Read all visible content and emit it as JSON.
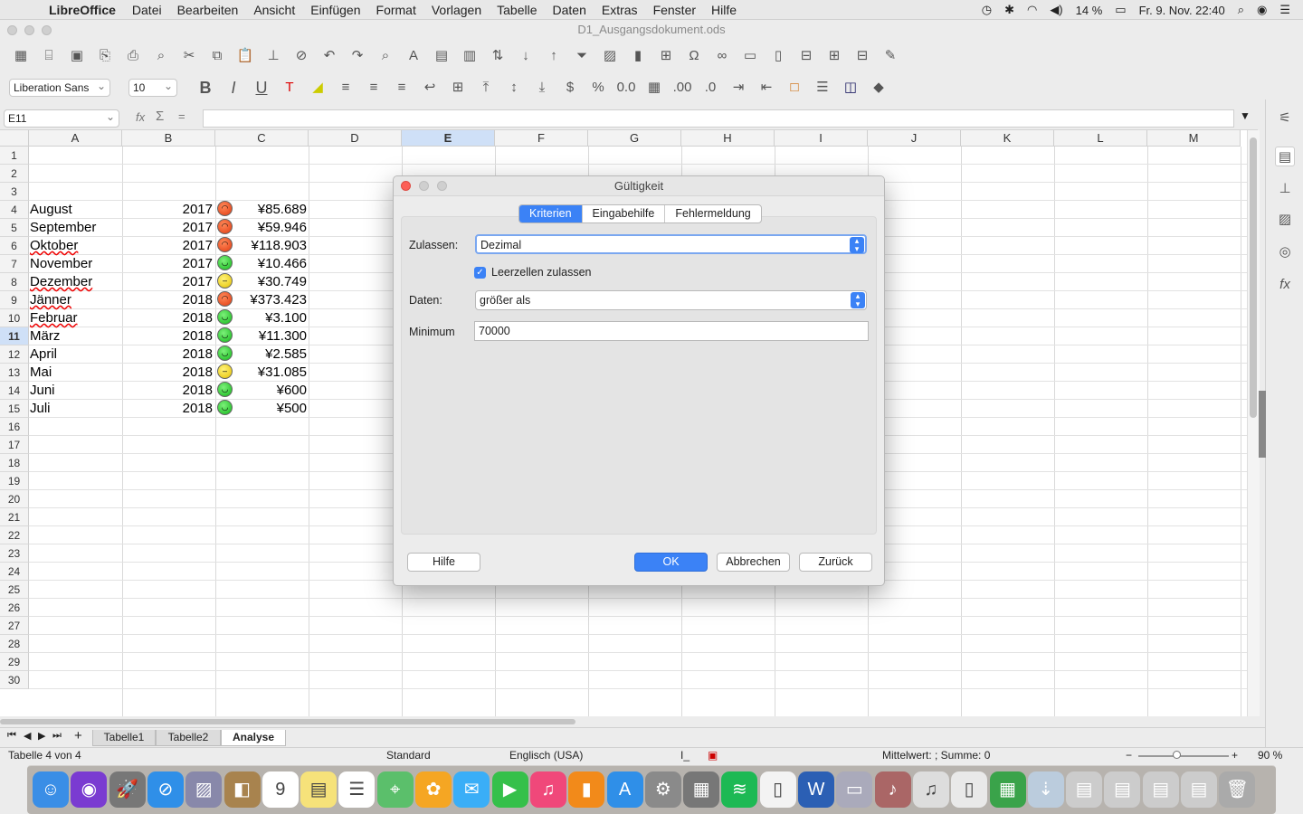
{
  "menubar": {
    "app": "LibreOffice",
    "items": [
      "Datei",
      "Bearbeiten",
      "Ansicht",
      "Einfügen",
      "Format",
      "Vorlagen",
      "Tabelle",
      "Daten",
      "Extras",
      "Fenster",
      "Hilfe"
    ],
    "battery": "14 %",
    "datetime": "Fr. 9. Nov.  22:40"
  },
  "window": {
    "title": "D1_Ausgangsdokument.ods"
  },
  "format_toolbar": {
    "font": "Liberation Sans",
    "size": "10"
  },
  "formula_bar": {
    "cell_ref": "E11",
    "fx": "fx",
    "sum": "Σ",
    "eq": "="
  },
  "columns": [
    "A",
    "B",
    "C",
    "D",
    "E",
    "F",
    "G",
    "H",
    "I",
    "J",
    "K",
    "L",
    "M"
  ],
  "rows": [
    "1",
    "2",
    "3",
    "4",
    "5",
    "6",
    "7",
    "8",
    "9",
    "10",
    "11",
    "12",
    "13",
    "14",
    "15",
    "16",
    "17",
    "18",
    "19",
    "20",
    "21",
    "22",
    "23",
    "24",
    "25",
    "26",
    "27",
    "28",
    "29",
    "30"
  ],
  "data_rows": [
    {
      "month": "August",
      "year": "2017",
      "mood": "red",
      "amount": "¥85.689"
    },
    {
      "month": "September",
      "year": "2017",
      "mood": "red",
      "amount": "¥59.946"
    },
    {
      "month": "Oktober",
      "year": "2017",
      "mood": "red",
      "amount": "¥118.903"
    },
    {
      "month": "November",
      "year": "2017",
      "mood": "green",
      "amount": "¥10.466"
    },
    {
      "month": "Dezember",
      "year": "2017",
      "mood": "yellow",
      "amount": "¥30.749"
    },
    {
      "month": "Jänner",
      "year": "2018",
      "mood": "red",
      "amount": "¥373.423"
    },
    {
      "month": "Februar",
      "year": "2018",
      "mood": "green",
      "amount": "¥3.100"
    },
    {
      "month": "März",
      "year": "2018",
      "mood": "green",
      "amount": "¥11.300"
    },
    {
      "month": "April",
      "year": "2018",
      "mood": "green",
      "amount": "¥2.585"
    },
    {
      "month": "Mai",
      "year": "2018",
      "mood": "yellow",
      "amount": "¥31.085"
    },
    {
      "month": "Juni",
      "year": "2018",
      "mood": "green",
      "amount": "¥600"
    },
    {
      "month": "Juli",
      "year": "2018",
      "mood": "green",
      "amount": "¥500"
    }
  ],
  "sheet_tabs": [
    "Tabelle1",
    "Tabelle2",
    "Analyse"
  ],
  "status": {
    "sheet": "Tabelle 4 von 4",
    "style": "Standard",
    "language": "Englisch (USA)",
    "stats": "Mittelwert: ; Summe: 0",
    "zoom": "90 %"
  },
  "dialog": {
    "title": "Gültigkeit",
    "tabs": [
      "Kriterien",
      "Eingabehilfe",
      "Fehlermeldung"
    ],
    "allow_label": "Zulassen:",
    "allow_value": "Dezimal",
    "empty_cells_label": "Leerzellen zulassen",
    "data_label": "Daten:",
    "data_value": "größer als",
    "minimum_label": "Minimum",
    "minimum_value": "70000",
    "help": "Hilfe",
    "ok": "OK",
    "cancel": "Abbrechen",
    "back": "Zurück"
  },
  "colors": {
    "accent": "#3b82f6"
  }
}
